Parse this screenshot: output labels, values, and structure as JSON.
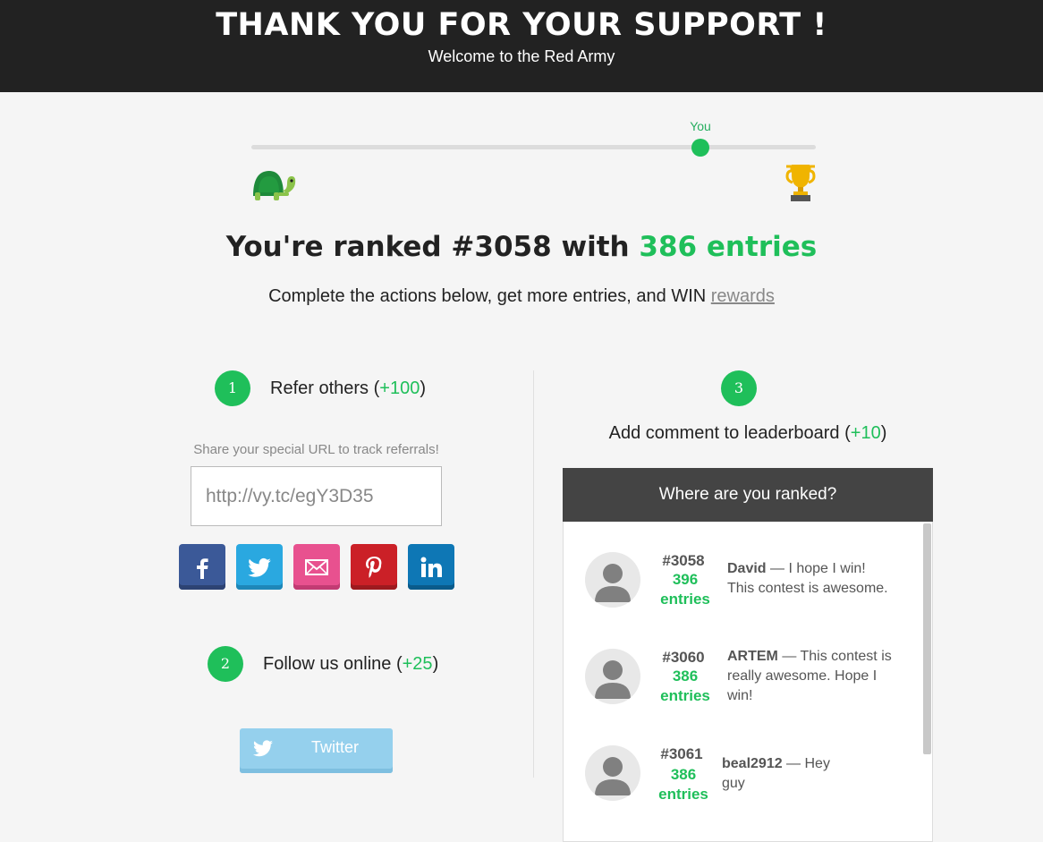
{
  "header": {
    "title": "THANK YOU FOR YOUR SUPPORT !",
    "subtitle": "Welcome to the Red Army"
  },
  "progress": {
    "marker_label": "You",
    "position_fraction": 0.795
  },
  "icons": {
    "start": "turtle-icon",
    "end": "trophy-icon"
  },
  "rank": {
    "prefix": "You're ranked #3058 with ",
    "entries": "386 entries"
  },
  "subline": {
    "text": "Complete the actions below, get more entries, and WIN ",
    "link": "rewards"
  },
  "steps": [
    {
      "number": "1",
      "title": "Refer others (",
      "points": "+100",
      "close": ")"
    },
    {
      "number": "2",
      "title": "Follow us online (",
      "points": "+25",
      "close": ")"
    },
    {
      "number": "3",
      "title": "Add comment to leaderboard (",
      "points": "+10",
      "close": ")"
    }
  ],
  "referral": {
    "hint": "Share your special URL to track referrals!",
    "url": "http://vy.tc/egY3D35"
  },
  "share_buttons": [
    "facebook",
    "twitter",
    "email",
    "pinterest",
    "linkedin"
  ],
  "follow": {
    "twitter_label": "Twitter"
  },
  "leaderboard": {
    "title": "Where are you ranked?",
    "rows": [
      {
        "rank": "#3058",
        "entries_num": "396",
        "entries_word": "entries",
        "name": "David",
        "comment_1": " — I hope I win!",
        "comment_2": "This contest is awesome.",
        "comment_3": ""
      },
      {
        "rank": "#3060",
        "entries_num": "386",
        "entries_word": "entries",
        "name": "ARTEM",
        "comment_1": " — This contest is",
        "comment_2": "really awesome. Hope I",
        "comment_3": "win!"
      },
      {
        "rank": "#3061",
        "entries_num": "386",
        "entries_word": "entries",
        "name": "beal2912",
        "comment_1": " — Hey",
        "comment_2": "guy",
        "comment_3": ""
      }
    ]
  },
  "colors": {
    "accent": "#1fbf5a",
    "header_bg": "#222222",
    "leaderboard_header_bg": "#444444"
  }
}
